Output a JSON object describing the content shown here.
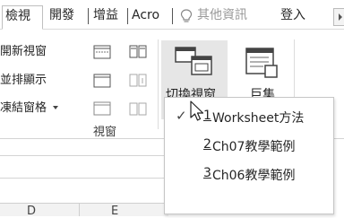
{
  "tabs": [
    {
      "label": "檢視",
      "active": true
    },
    {
      "label": "開發",
      "active": false
    },
    {
      "label": "增益",
      "active": false
    },
    {
      "label": "Acro",
      "active": false
    },
    {
      "label": "其他資訊",
      "active": false
    },
    {
      "label": "登入",
      "active": false
    }
  ],
  "tell_me_icon": "lightbulb-icon",
  "ribbon": {
    "left_commands": [
      {
        "label": "開新視窗",
        "icon": "new-window-icon"
      },
      {
        "label": "並排顯示",
        "icon": "arrange-all-icon"
      },
      {
        "label": "凍結窗格",
        "icon": "freeze-panes-icon",
        "has_dropdown": true
      }
    ],
    "switch_windows_label": "切換視窗",
    "macros_label": "巨集",
    "group_label": "視窗"
  },
  "menu": {
    "items": [
      {
        "number": "1",
        "text": " Worksheet方法",
        "checked": true
      },
      {
        "number": "2",
        "text": " Ch07教學範例",
        "checked": false
      },
      {
        "number": "3",
        "text": " Ch06教學範例",
        "checked": false
      }
    ]
  },
  "column_headers": [
    "D",
    "E"
  ],
  "colors": {
    "selected_button_bg": "#e6e6e6",
    "check": "#444444"
  }
}
